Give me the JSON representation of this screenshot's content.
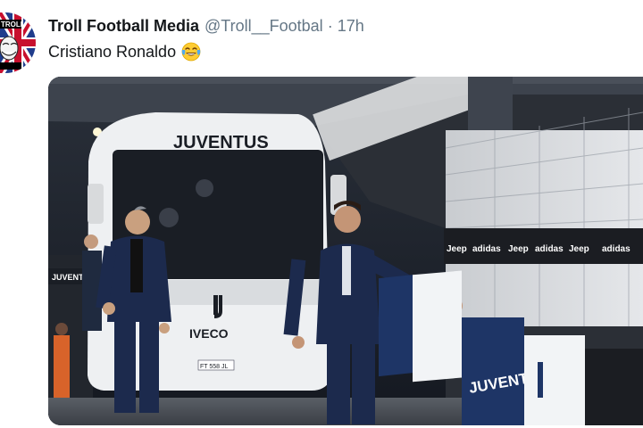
{
  "tweet": {
    "display_name": "Troll Football Media",
    "handle": "@Troll__Footbal",
    "separator": "·",
    "timestamp": "17h",
    "text": "Cristiano Ronaldo",
    "emoji": "face-with-tears-of-joy-icon"
  },
  "avatar": {
    "badge_text": "TROLL",
    "icon": "troll-face-union-jack-avatar"
  },
  "media": {
    "bus_brand": "JUVENTUS",
    "bus_maker": "IVECO",
    "bus_plate": "FT 558 JL",
    "bus_side_text": "JUVENTUS",
    "banner_text": "JUVENTUS",
    "sponsor_text": "adidas",
    "sponsor_text_2": "Jeep",
    "colors": {
      "bus_white": "#eef0f2",
      "suit_navy": "#1c2a4d",
      "tunnel_dark": "#1a1f29",
      "banner_navy": "#1e3566",
      "board_black": "#1b1d22"
    }
  }
}
